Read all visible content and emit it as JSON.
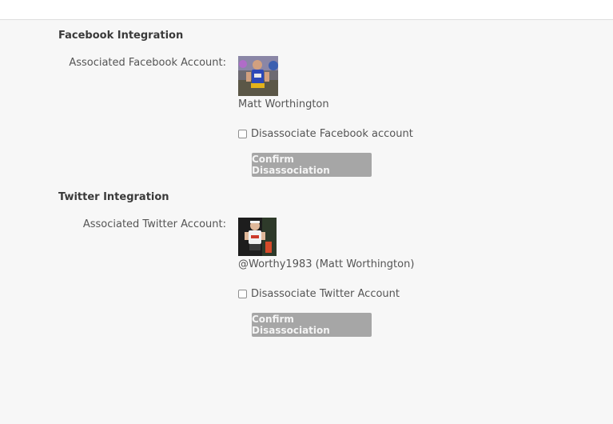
{
  "facebook": {
    "title": "Facebook Integration",
    "label": "Associated Facebook Account:",
    "account_name": "Matt Worthington",
    "checkbox_label": "Disassociate Facebook account",
    "button_label": "Confirm Disassociation"
  },
  "twitter": {
    "title": "Twitter Integration",
    "label": "Associated Twitter Account:",
    "account_name": "@Worthy1983 (Matt Worthington)",
    "checkbox_label": "Disassociate Twitter Account",
    "button_label": "Confirm Disassociation"
  }
}
